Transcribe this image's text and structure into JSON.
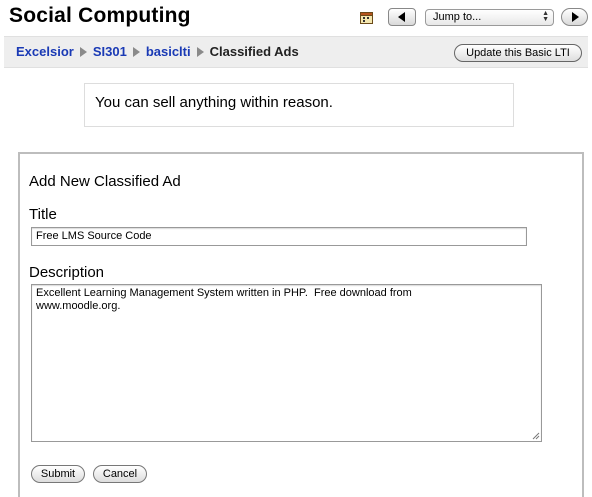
{
  "header": {
    "site_title": "Social Computing",
    "icons": [
      "calendar-icon",
      "prev-arrow-icon",
      "next-arrow-icon"
    ],
    "jump_select": {
      "selected": "Jump to..."
    }
  },
  "breadcrumb": {
    "items": [
      "Excelsior",
      "SI301",
      "basiclti"
    ],
    "current": "Classified Ads"
  },
  "navbar": {
    "update_button_label": "Update this Basic LTI"
  },
  "intro": {
    "text": "You can sell anything within reason."
  },
  "form": {
    "heading": "Add New Classified Ad",
    "title_label": "Title",
    "title_value": "Free LMS Source Code",
    "description_label": "Description",
    "description_value": "Excellent Learning Management System written in PHP.  Free download from\nwww.moodle.org.",
    "submit_label": "Submit",
    "cancel_label": "Cancel"
  },
  "colors": {
    "link": "#1a3ab5",
    "navbar_bg": "#eeeeee",
    "separator": "#8a8a8a"
  }
}
